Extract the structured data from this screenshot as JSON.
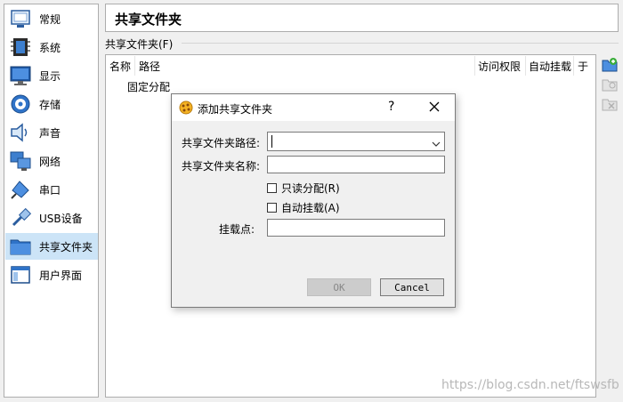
{
  "sidebar": {
    "items": [
      {
        "label": "常规",
        "icon": "general-settings-icon",
        "selected": false
      },
      {
        "label": "系统",
        "icon": "system-chip-icon",
        "selected": false
      },
      {
        "label": "显示",
        "icon": "display-monitor-icon",
        "selected": false
      },
      {
        "label": "存储",
        "icon": "storage-disk-icon",
        "selected": false
      },
      {
        "label": "声音",
        "icon": "audio-speaker-icon",
        "selected": false
      },
      {
        "label": "网络",
        "icon": "network-icon",
        "selected": false
      },
      {
        "label": "串口",
        "icon": "serial-port-icon",
        "selected": false
      },
      {
        "label": "USB设备",
        "icon": "usb-icon",
        "selected": false
      },
      {
        "label": "共享文件夹",
        "icon": "shared-folder-icon",
        "selected": true
      },
      {
        "label": "用户界面",
        "icon": "user-interface-icon",
        "selected": false
      }
    ]
  },
  "page": {
    "title": "共享文件夹",
    "group_label": "共享文件夹(F)"
  },
  "table": {
    "columns": [
      "名称",
      "路径",
      "访问权限",
      "自动挂载",
      "于"
    ],
    "rows": [
      "固定分配"
    ]
  },
  "dialog": {
    "title": "添加共享文件夹",
    "help": "?",
    "path_label": "共享文件夹路径:",
    "path_value": "",
    "name_label": "共享文件夹名称:",
    "name_value": "",
    "readonly_label": "只读分配(R)",
    "readonly_checked": false,
    "automount_label": "自动挂载(A)",
    "automount_checked": false,
    "mountpoint_label": "挂载点:",
    "mountpoint_value": "",
    "ok_label": "OK",
    "cancel_label": "Cancel"
  },
  "watermark": "https://blog.csdn.net/ftswsfb",
  "colors": {
    "selection": "#cce4f7",
    "window_bg": "#f0f0f0",
    "border": "#adadad"
  }
}
